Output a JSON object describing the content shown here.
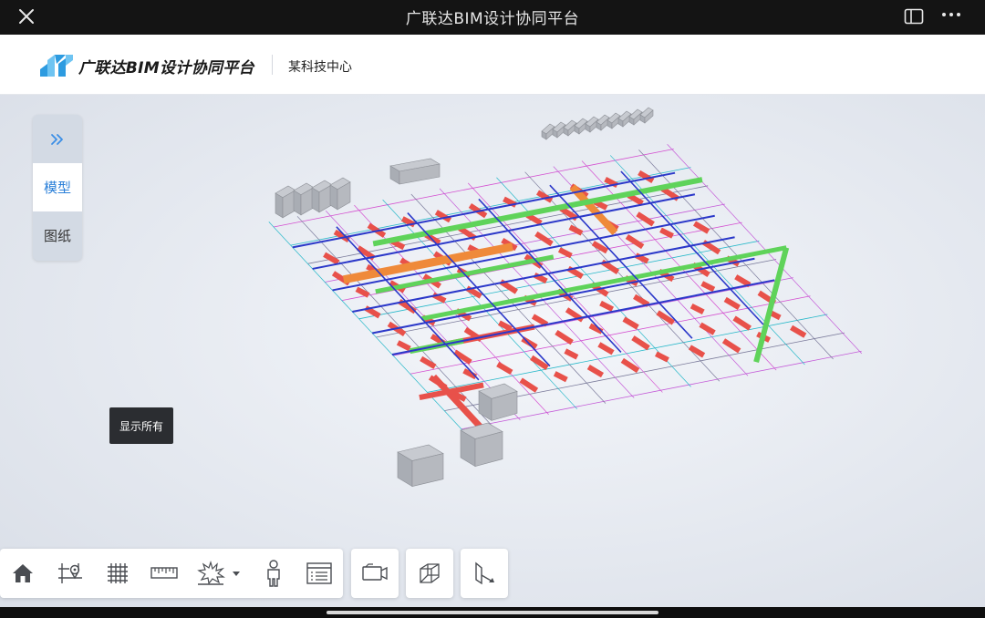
{
  "window": {
    "title": "广联达BIM设计协同平台",
    "close_icon": "close-icon",
    "sidebar_icon": "sidebar-toggle-icon",
    "more_icon": "more-icon"
  },
  "header": {
    "brand": "广联达BIM设计协同平台",
    "organization": "某科技中心",
    "brand_color": "#2d9be0"
  },
  "side_panel": {
    "expand_icon": "double-chevron-right-icon",
    "tabs": [
      {
        "label": "模型",
        "active": true
      },
      {
        "label": "图纸",
        "active": false
      }
    ],
    "accent": "#2a7fd8"
  },
  "viewport": {
    "show_all_label": "显示所有",
    "model_colors": {
      "duct_red": "#e8514a",
      "pipe_green": "#5fd35a",
      "duct_orange": "#ef8a3a",
      "pipe_blue": "#2b38c9",
      "equipment_gray": "#a9adb4"
    }
  },
  "toolbar": {
    "tools": [
      {
        "name": "home",
        "icon": "home-icon"
      },
      {
        "name": "pick-point",
        "icon": "location-pin-icon"
      },
      {
        "name": "grid",
        "icon": "grid-icon"
      },
      {
        "name": "measure",
        "icon": "ruler-icon"
      },
      {
        "name": "explode",
        "icon": "explode-icon"
      },
      {
        "name": "person",
        "icon": "person-icon"
      },
      {
        "name": "properties",
        "icon": "list-panel-icon"
      }
    ],
    "extra": [
      {
        "name": "camera",
        "icon": "camera-icon"
      },
      {
        "name": "section-box",
        "icon": "cube-icon"
      },
      {
        "name": "plane-section",
        "icon": "plane-section-icon"
      }
    ]
  }
}
